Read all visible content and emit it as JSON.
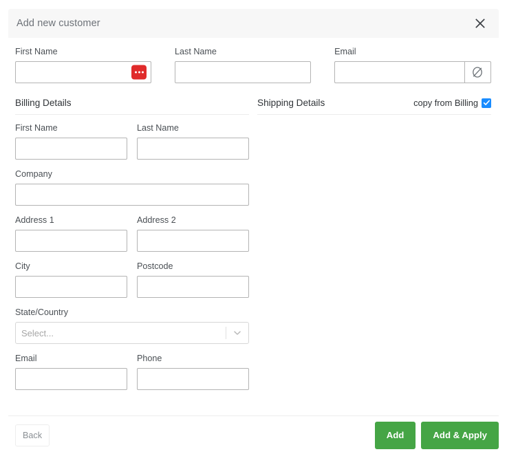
{
  "modal": {
    "title": "Add new customer",
    "close_icon": "close-icon"
  },
  "top_fields": {
    "first_name": {
      "label": "First Name",
      "value": "",
      "placeholder": "",
      "badge_icon": "ellipsis-icon",
      "badge_color": "#e02b2b"
    },
    "last_name": {
      "label": "Last Name",
      "value": "",
      "placeholder": ""
    },
    "email": {
      "label": "Email",
      "value": "",
      "placeholder": "",
      "addon_icon": "empty-set-icon"
    }
  },
  "billing": {
    "section_title": "Billing Details",
    "fields": {
      "first_name": {
        "label": "First Name",
        "value": "",
        "placeholder": ""
      },
      "last_name": {
        "label": "Last Name",
        "value": "",
        "placeholder": ""
      },
      "company": {
        "label": "Company",
        "value": "",
        "placeholder": ""
      },
      "address1": {
        "label": "Address 1",
        "value": "",
        "placeholder": ""
      },
      "address2": {
        "label": "Address 2",
        "value": "",
        "placeholder": ""
      },
      "city": {
        "label": "City",
        "value": "",
        "placeholder": ""
      },
      "postcode": {
        "label": "Postcode",
        "value": "",
        "placeholder": ""
      },
      "state_country": {
        "label": "State/Country",
        "selected": "Select...",
        "arrow_icon": "chevron-down-icon"
      },
      "email": {
        "label": "Email",
        "value": "",
        "placeholder": ""
      },
      "phone": {
        "label": "Phone",
        "value": "",
        "placeholder": ""
      }
    }
  },
  "shipping": {
    "section_title": "Shipping Details",
    "copy_from_billing_label": "copy from Billing",
    "copy_from_billing_checked": true,
    "checkbox_color": "#1a8cff"
  },
  "footer": {
    "back_label": "Back",
    "add_label": "Add",
    "add_apply_label": "Add & Apply",
    "primary_color": "#45a545"
  }
}
